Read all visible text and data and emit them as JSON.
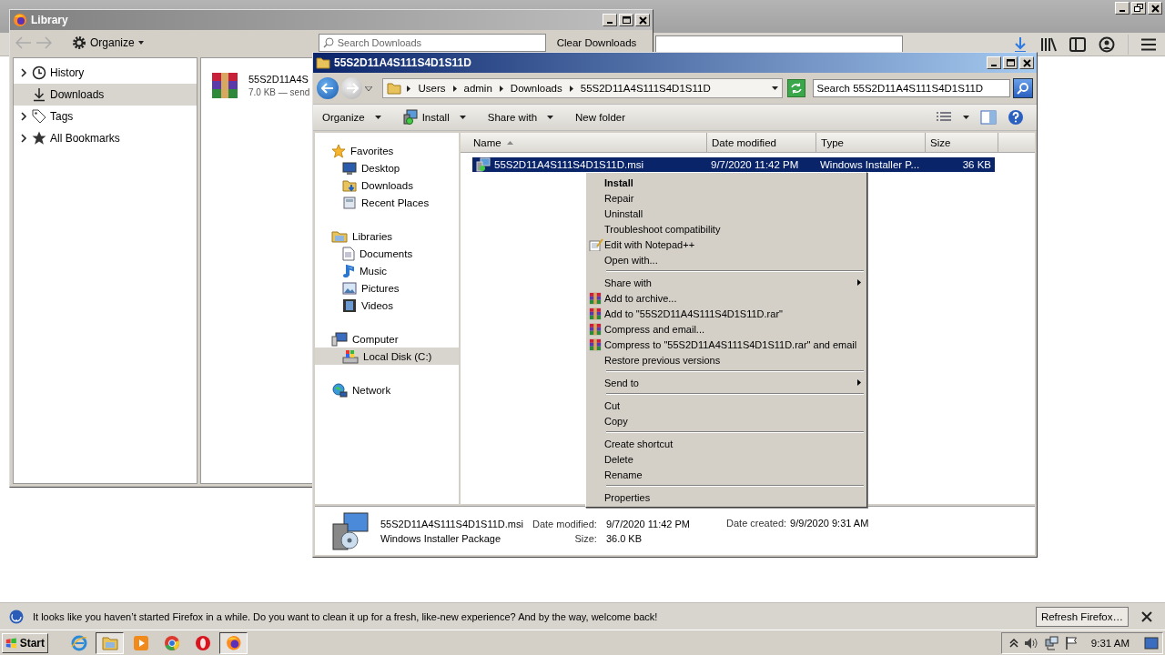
{
  "library": {
    "title": "Library",
    "organize": "Organize",
    "search_placeholder": "Search Downloads",
    "clear_button": "Clear Downloads",
    "sidebar": [
      {
        "label": "History",
        "kind": "history",
        "expandable": true,
        "selected": false
      },
      {
        "label": "Downloads",
        "kind": "downloads",
        "expandable": false,
        "selected": true
      },
      {
        "label": "Tags",
        "kind": "tags",
        "expandable": true,
        "selected": false
      },
      {
        "label": "All Bookmarks",
        "kind": "bookmarks",
        "expandable": true,
        "selected": false
      }
    ],
    "downloads": [
      {
        "name": "55S2D11A4S",
        "status": "7.0 KB — send"
      }
    ]
  },
  "explorer": {
    "title": "55S2D11A4S111S4D1S11D",
    "breadcrumb": [
      "Users",
      "admin",
      "Downloads",
      "55S2D11A4S111S4D1S11D"
    ],
    "search_placeholder": "Search 55S2D11A4S111S4D1S11D",
    "toolbar": [
      {
        "label": "Organize",
        "kind": "plain",
        "dropdown": true
      },
      {
        "label": "Install",
        "kind": "install",
        "dropdown": true
      },
      {
        "label": "Share with",
        "kind": "plain",
        "dropdown": true
      },
      {
        "label": "New folder",
        "kind": "plain",
        "dropdown": false
      }
    ],
    "nav": [
      {
        "label": "Favorites",
        "kind": "star",
        "selected": false,
        "children": [
          {
            "label": "Desktop",
            "kind": "desktop",
            "selected": false
          },
          {
            "label": "Downloads",
            "kind": "downloads",
            "selected": false
          },
          {
            "label": "Recent Places",
            "kind": "recent",
            "selected": false
          }
        ]
      },
      {
        "label": "Libraries",
        "kind": "libraries",
        "selected": false,
        "children": [
          {
            "label": "Documents",
            "kind": "document",
            "selected": false
          },
          {
            "label": "Music",
            "kind": "music",
            "selected": false
          },
          {
            "label": "Pictures",
            "kind": "pictures",
            "selected": false
          },
          {
            "label": "Videos",
            "kind": "videos",
            "selected": false
          }
        ]
      },
      {
        "label": "Computer",
        "kind": "computer",
        "selected": false,
        "children": [
          {
            "label": "Local Disk (C:)",
            "kind": "disk",
            "selected": true
          }
        ]
      },
      {
        "label": "Network",
        "kind": "network",
        "selected": false
      }
    ],
    "columns": [
      {
        "label": "Name",
        "sorted": true
      },
      {
        "label": "Date modified",
        "sorted": false
      },
      {
        "label": "Type",
        "sorted": false
      },
      {
        "label": "Size",
        "sorted": false
      }
    ],
    "rows": [
      {
        "name": "55S2D11A4S111S4D1S11D.msi",
        "date": "9/7/2020 11:42 PM",
        "type": "Windows Installer P...",
        "size": "36 KB",
        "selected": true
      }
    ],
    "details": {
      "name": "55S2D11A4S111S4D1S11D.msi",
      "type": "Windows Installer Package",
      "modified_label": "Date modified:",
      "modified": "9/7/2020 11:42 PM",
      "size_label": "Size:",
      "size": "36.0 KB",
      "created_label": "Date created:",
      "created": "9/9/2020 9:31 AM"
    }
  },
  "context_menu": [
    {
      "kind": "plain",
      "label": "Install",
      "default": true,
      "submenu": false
    },
    {
      "kind": "plain",
      "label": "Repair",
      "default": false,
      "submenu": false
    },
    {
      "kind": "plain",
      "label": "Uninstall",
      "default": false,
      "submenu": false
    },
    {
      "kind": "plain",
      "label": "Troubleshoot compatibility",
      "default": false,
      "submenu": false
    },
    {
      "kind": "notepad",
      "label": "Edit with Notepad++",
      "default": false,
      "submenu": false
    },
    {
      "kind": "plain",
      "label": "Open with...",
      "default": false,
      "submenu": false
    },
    {
      "kind": "separator"
    },
    {
      "kind": "plain",
      "label": "Share with",
      "default": false,
      "submenu": true
    },
    {
      "kind": "winrar",
      "label": "Add to archive...",
      "default": false,
      "submenu": false
    },
    {
      "kind": "winrar",
      "label": "Add to \"55S2D11A4S111S4D1S11D.rar\"",
      "default": false,
      "submenu": false
    },
    {
      "kind": "winrar",
      "label": "Compress and email...",
      "default": false,
      "submenu": false
    },
    {
      "kind": "winrar",
      "label": "Compress to \"55S2D11A4S111S4D1S11D.rar\" and email",
      "default": false,
      "submenu": false
    },
    {
      "kind": "plain",
      "label": "Restore previous versions",
      "default": false,
      "submenu": false
    },
    {
      "kind": "separator"
    },
    {
      "kind": "plain",
      "label": "Send to",
      "default": false,
      "submenu": true
    },
    {
      "kind": "separator"
    },
    {
      "kind": "plain",
      "label": "Cut",
      "default": false,
      "submenu": false
    },
    {
      "kind": "plain",
      "label": "Copy",
      "default": false,
      "submenu": false
    },
    {
      "kind": "separator"
    },
    {
      "kind": "plain",
      "label": "Create shortcut",
      "default": false,
      "submenu": false
    },
    {
      "kind": "plain",
      "label": "Delete",
      "default": false,
      "submenu": false
    },
    {
      "kind": "plain",
      "label": "Rename",
      "default": false,
      "submenu": false
    },
    {
      "kind": "separator"
    },
    {
      "kind": "plain",
      "label": "Properties",
      "default": false,
      "submenu": false
    }
  ],
  "notification": {
    "text": "It looks like you haven’t started Firefox in a while. Do you want to clean it up for a fresh, like-new experience? And by the way, welcome back!",
    "button": "Refresh Firefox…"
  },
  "taskbar": {
    "start": "Start",
    "apps": [
      {
        "kind": "ie",
        "selected": false
      },
      {
        "kind": "explorer",
        "selected": true
      },
      {
        "kind": "media",
        "selected": false
      },
      {
        "kind": "chrome",
        "selected": false
      },
      {
        "kind": "opera",
        "selected": false
      },
      {
        "kind": "firefox",
        "selected": true
      }
    ],
    "clock": "9:31 AM"
  }
}
